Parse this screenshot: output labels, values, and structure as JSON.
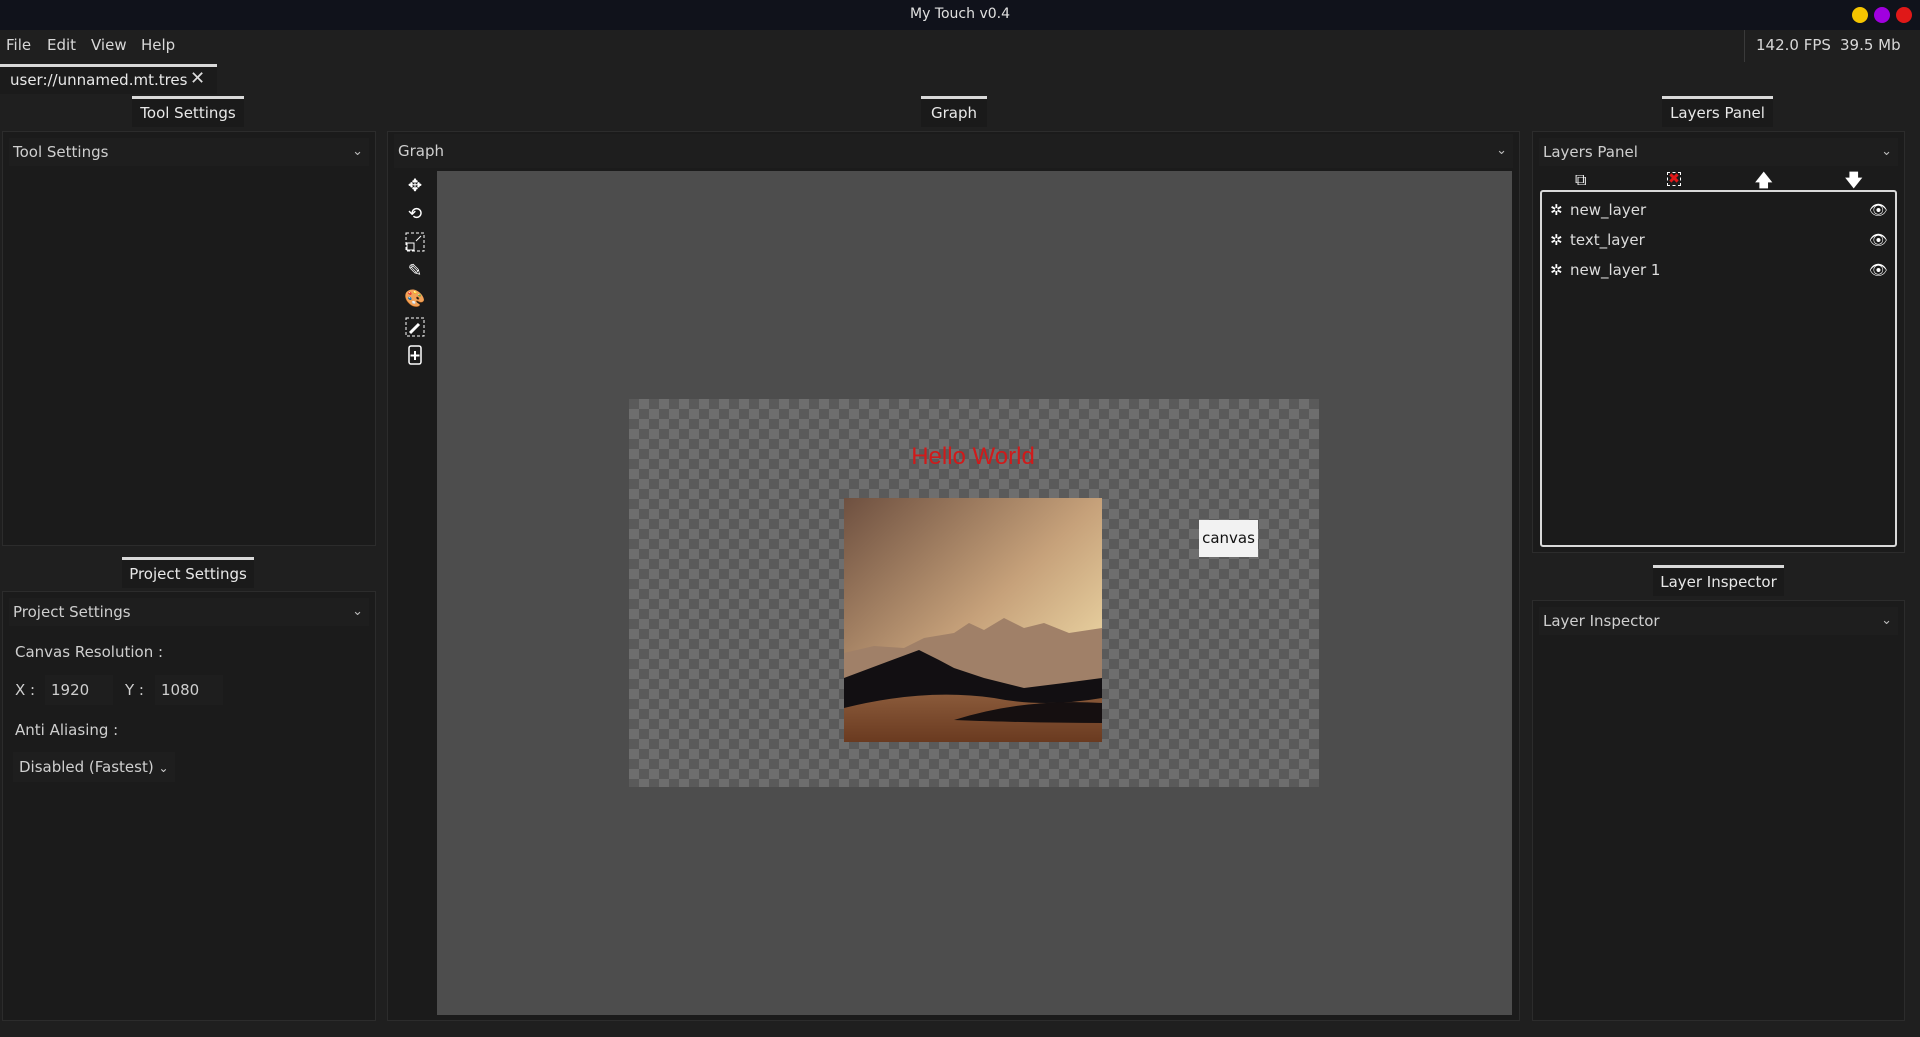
{
  "window": {
    "title": "My Touch v0.4",
    "controls": [
      {
        "name": "minimize",
        "color": "#f5c400"
      },
      {
        "name": "maximize",
        "color": "#a000e0"
      },
      {
        "name": "close",
        "color": "#e01818"
      }
    ]
  },
  "menu": [
    "File",
    "Edit",
    "View",
    "Help"
  ],
  "status": {
    "fps": "142.0 FPS",
    "memory": "39.5 Mb"
  },
  "file_tab": {
    "label": "user://unnamed.mt.tres",
    "close_icon": "close-icon"
  },
  "tool_settings": {
    "tab": "Tool Settings",
    "header": "Tool Settings"
  },
  "project_settings": {
    "tab": "Project Settings",
    "header": "Project Settings",
    "canvas_resolution_label": "Canvas Resolution :",
    "x_label": "X :",
    "x_value": "1920",
    "y_label": "Y :",
    "y_value": "1080",
    "anti_aliasing_label": "Anti Aliasing :",
    "anti_aliasing_value": "Disabled (Fastest)"
  },
  "graph": {
    "tab": "Graph",
    "header": "Graph",
    "tools": [
      "move-icon",
      "rotate-icon",
      "scale-icon",
      "pencil-icon",
      "palette-icon",
      "eyedropper-icon",
      "add-file-icon"
    ],
    "canvas": {
      "text_layer": "Hello World",
      "text_color": "#d01a1a",
      "node_label": "canvas",
      "viewport_color": "#4d4d4d"
    }
  },
  "layers_panel": {
    "tab": "Layers Panel",
    "header": "Layers Panel",
    "actions": [
      "duplicate-icon",
      "delete-icon",
      "move-up-icon",
      "move-down-icon"
    ],
    "layers": [
      {
        "name": "new_layer",
        "visible": true
      },
      {
        "name": "text_layer",
        "visible": true
      },
      {
        "name": "new_layer 1",
        "visible": true
      }
    ]
  },
  "layer_inspector": {
    "tab": "Layer Inspector",
    "header": "Layer Inspector"
  }
}
